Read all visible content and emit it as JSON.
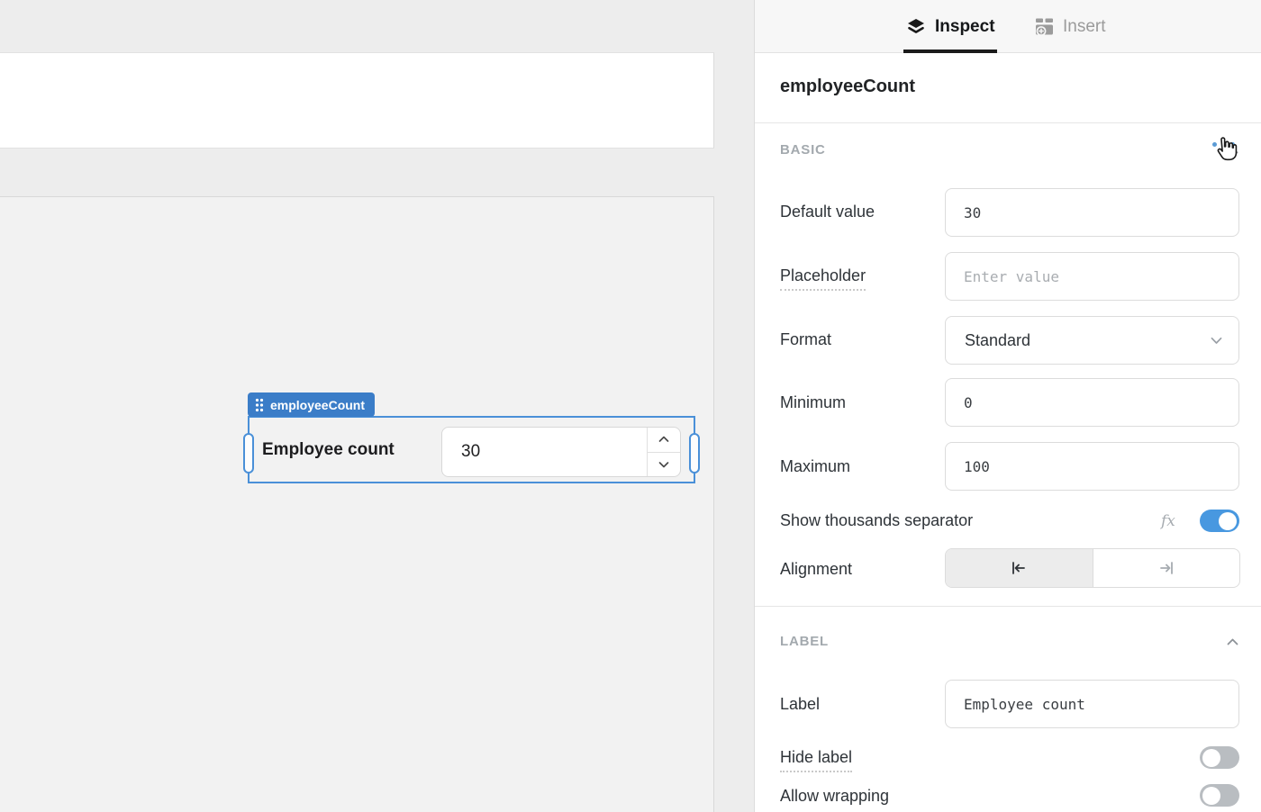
{
  "canvas": {
    "selected_component": {
      "tag": "employeeCount",
      "label": "Employee count",
      "value": "30"
    }
  },
  "inspector": {
    "tabs": {
      "inspect": "Inspect",
      "insert": "Insert"
    },
    "title": "employeeCount",
    "basic": {
      "title": "BASIC",
      "default_value_label": "Default value",
      "default_value": "30",
      "placeholder_label": "Placeholder",
      "placeholder_hint": "Enter value",
      "format_label": "Format",
      "format_value": "Standard",
      "minimum_label": "Minimum",
      "minimum_value": "0",
      "maximum_label": "Maximum",
      "maximum_value": "100",
      "thousands_label": "Show thousands separator",
      "fx_label": "fx",
      "thousands_on": true,
      "alignment_label": "Alignment"
    },
    "label_section": {
      "title": "LABEL",
      "label_label": "Label",
      "label_value": "Employee count",
      "hide_label_label": "Hide label",
      "hide_label_on": false,
      "allow_wrapping_label": "Allow wrapping",
      "allow_wrapping_on": false
    },
    "colors": {
      "accent": "#4898e0",
      "tag": "#3b7dc8",
      "selection": "#4a90d8"
    }
  }
}
